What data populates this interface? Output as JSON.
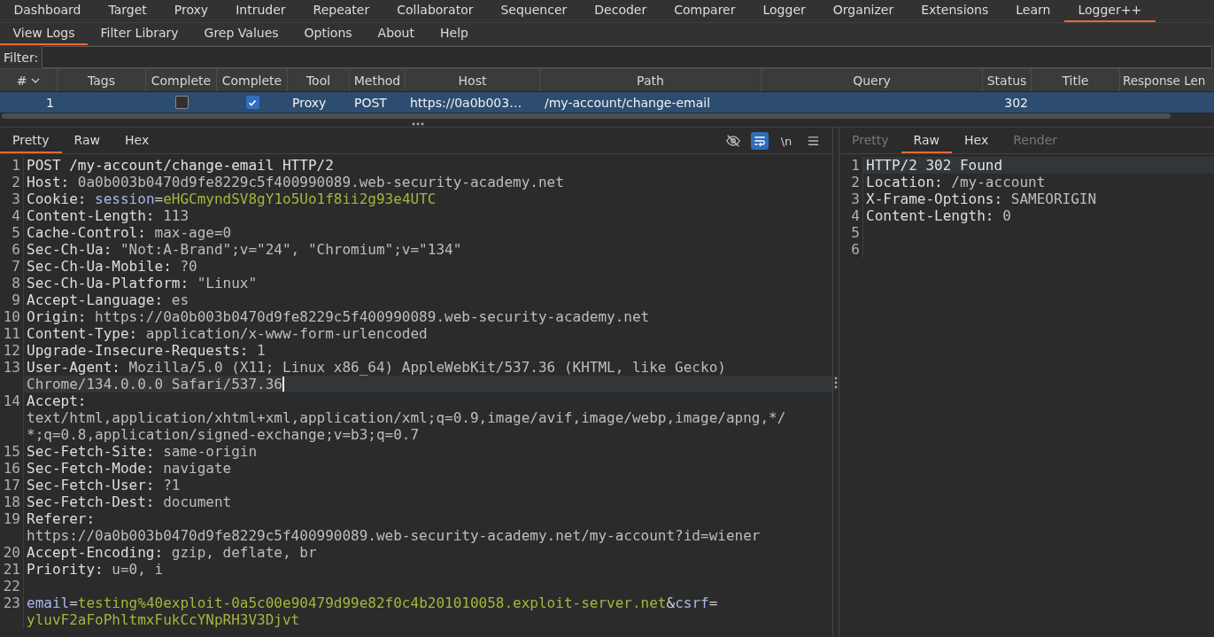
{
  "main_tabs": [
    {
      "label": "Dashboard",
      "selected": false
    },
    {
      "label": "Target",
      "selected": false
    },
    {
      "label": "Proxy",
      "selected": false
    },
    {
      "label": "Intruder",
      "selected": false
    },
    {
      "label": "Repeater",
      "selected": false
    },
    {
      "label": "Collaborator",
      "selected": false
    },
    {
      "label": "Sequencer",
      "selected": false
    },
    {
      "label": "Decoder",
      "selected": false
    },
    {
      "label": "Comparer",
      "selected": false
    },
    {
      "label": "Logger",
      "selected": false
    },
    {
      "label": "Organizer",
      "selected": false
    },
    {
      "label": "Extensions",
      "selected": false
    },
    {
      "label": "Learn",
      "selected": false
    },
    {
      "label": "Logger++",
      "selected": true
    }
  ],
  "sub_tabs": [
    {
      "label": "View Logs",
      "selected": true
    },
    {
      "label": "Filter Library",
      "selected": false
    },
    {
      "label": "Grep Values",
      "selected": false
    },
    {
      "label": "Options",
      "selected": false
    },
    {
      "label": "About",
      "selected": false
    },
    {
      "label": "Help",
      "selected": false
    }
  ],
  "filter": {
    "label": "Filter:"
  },
  "table": {
    "columns": [
      {
        "label": "#",
        "sorted": true
      },
      {
        "label": "Tags",
        "sorted": false
      },
      {
        "label": "Complete",
        "sorted": false
      },
      {
        "label": "Complete",
        "sorted": false
      },
      {
        "label": "Tool",
        "sorted": false
      },
      {
        "label": "Method",
        "sorted": false
      },
      {
        "label": "Host",
        "sorted": false
      },
      {
        "label": "Path",
        "sorted": false
      },
      {
        "label": "Query",
        "sorted": false
      },
      {
        "label": "Status",
        "sorted": false
      },
      {
        "label": "Title",
        "sorted": false
      },
      {
        "label": "Response Len",
        "sorted": false
      }
    ],
    "rows": [
      {
        "selected": true,
        "cells": [
          {
            "kind": "number",
            "text": "1"
          },
          {
            "kind": "empty"
          },
          {
            "kind": "checkbox",
            "checked": false
          },
          {
            "kind": "checkbox",
            "checked": true
          },
          {
            "kind": "text",
            "text": "Proxy"
          },
          {
            "kind": "text",
            "text": "POST"
          },
          {
            "kind": "text",
            "text": "https://0a0b003…"
          },
          {
            "kind": "text",
            "text": "/my-account/change-email"
          },
          {
            "kind": "empty"
          },
          {
            "kind": "number",
            "text": "302"
          },
          {
            "kind": "empty"
          },
          {
            "kind": "empty"
          }
        ]
      }
    ]
  },
  "request": {
    "tabs": [
      {
        "label": "Pretty",
        "selected": true,
        "disabled": false
      },
      {
        "label": "Raw",
        "selected": false,
        "disabled": false
      },
      {
        "label": "Hex",
        "selected": false,
        "disabled": false
      }
    ],
    "toolbar": [
      {
        "kind": "hide",
        "selected": false
      },
      {
        "kind": "wrap",
        "selected": true
      },
      {
        "kind": "text",
        "text": "\\n",
        "selected": false
      },
      {
        "kind": "menu",
        "selected": false
      }
    ],
    "lines": [
      {
        "number": "1",
        "cursor": false,
        "rows": [
          [
            {
              "kind": "plain",
              "text": "POST /my-account/change-email HTTP/2"
            }
          ]
        ]
      },
      {
        "number": "2",
        "cursor": false,
        "rows": [
          [
            {
              "kind": "name",
              "text": "Host:"
            },
            {
              "kind": "value",
              "text": " 0a0b003b0470d9fe8229c5f400990089.web-security-academy.net"
            }
          ]
        ]
      },
      {
        "number": "3",
        "cursor": false,
        "rows": [
          [
            {
              "kind": "name",
              "text": "Cookie:"
            },
            {
              "kind": "value",
              "text": " "
            },
            {
              "kind": "param",
              "text": "session"
            },
            {
              "kind": "sep",
              "text": "="
            },
            {
              "kind": "param-value",
              "text": "eHGCmyndSV8gY1o5Uo1f8ii2g93e4UTC"
            }
          ]
        ]
      },
      {
        "number": "4",
        "cursor": false,
        "rows": [
          [
            {
              "kind": "name",
              "text": "Content-Length:"
            },
            {
              "kind": "value",
              "text": " 113"
            }
          ]
        ]
      },
      {
        "number": "5",
        "cursor": false,
        "rows": [
          [
            {
              "kind": "name",
              "text": "Cache-Control:"
            },
            {
              "kind": "value",
              "text": " max-age=0"
            }
          ]
        ]
      },
      {
        "number": "6",
        "cursor": false,
        "rows": [
          [
            {
              "kind": "name",
              "text": "Sec-Ch-Ua:"
            },
            {
              "kind": "value",
              "text": " \"Not:A-Brand\";v=\"24\", \"Chromium\";v=\"134\""
            }
          ]
        ]
      },
      {
        "number": "7",
        "cursor": false,
        "rows": [
          [
            {
              "kind": "name",
              "text": "Sec-Ch-Ua-Mobile:"
            },
            {
              "kind": "value",
              "text": " ?0"
            }
          ]
        ]
      },
      {
        "number": "8",
        "cursor": false,
        "rows": [
          [
            {
              "kind": "name",
              "text": "Sec-Ch-Ua-Platform:"
            },
            {
              "kind": "value",
              "text": " \"Linux\""
            }
          ]
        ]
      },
      {
        "number": "9",
        "cursor": false,
        "rows": [
          [
            {
              "kind": "name",
              "text": "Accept-Language:"
            },
            {
              "kind": "value",
              "text": " es"
            }
          ]
        ]
      },
      {
        "number": "10",
        "cursor": false,
        "rows": [
          [
            {
              "kind": "name",
              "text": "Origin:"
            },
            {
              "kind": "value",
              "text": " https://0a0b003b0470d9fe8229c5f400990089.web-security-academy.net"
            }
          ]
        ]
      },
      {
        "number": "11",
        "cursor": false,
        "rows": [
          [
            {
              "kind": "name",
              "text": "Content-Type:"
            },
            {
              "kind": "value",
              "text": " application/x-www-form-urlencoded"
            }
          ]
        ]
      },
      {
        "number": "12",
        "cursor": false,
        "rows": [
          [
            {
              "kind": "name",
              "text": "Upgrade-Insecure-Requests:"
            },
            {
              "kind": "value",
              "text": " 1"
            }
          ]
        ]
      },
      {
        "number": "13",
        "cursor": true,
        "rows": [
          [
            {
              "kind": "name",
              "text": "User-Agent:"
            },
            {
              "kind": "value",
              "text": " Mozilla/5.0 (X11; Linux x86_64) AppleWebKit/537.36 (KHTML, like Gecko)"
            }
          ],
          [
            {
              "kind": "value",
              "text": "Chrome/134.0.0.0 Safari/537.36"
            }
          ]
        ]
      },
      {
        "number": "14",
        "cursor": false,
        "rows": [
          [
            {
              "kind": "name",
              "text": "Accept:"
            }
          ],
          [
            {
              "kind": "value",
              "text": "text/html,application/xhtml+xml,application/xml;q=0.9,image/avif,image/webp,image/apng,*/"
            }
          ],
          [
            {
              "kind": "value",
              "text": "*;q=0.8,application/signed-exchange;v=b3;q=0.7"
            }
          ]
        ]
      },
      {
        "number": "15",
        "cursor": false,
        "rows": [
          [
            {
              "kind": "name",
              "text": "Sec-Fetch-Site:"
            },
            {
              "kind": "value",
              "text": " same-origin"
            }
          ]
        ]
      },
      {
        "number": "16",
        "cursor": false,
        "rows": [
          [
            {
              "kind": "name",
              "text": "Sec-Fetch-Mode:"
            },
            {
              "kind": "value",
              "text": " navigate"
            }
          ]
        ]
      },
      {
        "number": "17",
        "cursor": false,
        "rows": [
          [
            {
              "kind": "name",
              "text": "Sec-Fetch-User:"
            },
            {
              "kind": "value",
              "text": " ?1"
            }
          ]
        ]
      },
      {
        "number": "18",
        "cursor": false,
        "rows": [
          [
            {
              "kind": "name",
              "text": "Sec-Fetch-Dest:"
            },
            {
              "kind": "value",
              "text": " document"
            }
          ]
        ]
      },
      {
        "number": "19",
        "cursor": false,
        "rows": [
          [
            {
              "kind": "name",
              "text": "Referer:"
            }
          ],
          [
            {
              "kind": "value",
              "text": "https://0a0b003b0470d9fe8229c5f400990089.web-security-academy.net/my-account?id=wiener"
            }
          ]
        ]
      },
      {
        "number": "20",
        "cursor": false,
        "rows": [
          [
            {
              "kind": "name",
              "text": "Accept-Encoding:"
            },
            {
              "kind": "value",
              "text": " gzip, deflate, br"
            }
          ]
        ]
      },
      {
        "number": "21",
        "cursor": false,
        "rows": [
          [
            {
              "kind": "name",
              "text": "Priority:"
            },
            {
              "kind": "value",
              "text": " u=0, i"
            }
          ]
        ]
      },
      {
        "number": "22",
        "cursor": false
      },
      {
        "number": "23",
        "cursor": false,
        "rows": [
          [
            {
              "kind": "param",
              "text": "email"
            },
            {
              "kind": "sep",
              "text": "="
            },
            {
              "kind": "param-value",
              "text": "testing%40exploit-0a5c00e90479d99e82f0c4b201010058.exploit-server.net"
            },
            {
              "kind": "sep",
              "text": "&"
            },
            {
              "kind": "param",
              "text": "csrf"
            },
            {
              "kind": "sep",
              "text": "="
            }
          ],
          [
            {
              "kind": "param-value",
              "text": "yluvF2aFoPhltmxFukCcYNpRH3V3Djvt"
            }
          ]
        ]
      }
    ]
  },
  "response": {
    "tabs": [
      {
        "label": "Pretty",
        "selected": false,
        "disabled": true
      },
      {
        "label": "Raw",
        "selected": true,
        "disabled": false
      },
      {
        "label": "Hex",
        "selected": false,
        "disabled": false
      },
      {
        "label": "Render",
        "selected": false,
        "disabled": true
      }
    ],
    "lines": [
      {
        "number": "1",
        "cursor": true,
        "rows": [
          [
            {
              "kind": "plain",
              "text": "HTTP/2 302 Found"
            }
          ]
        ]
      },
      {
        "number": "2",
        "cursor": false,
        "rows": [
          [
            {
              "kind": "name",
              "text": "Location:"
            },
            {
              "kind": "value",
              "text": " /my-account"
            }
          ]
        ]
      },
      {
        "number": "3",
        "cursor": false,
        "rows": [
          [
            {
              "kind": "name",
              "text": "X-Frame-Options:"
            },
            {
              "kind": "value",
              "text": " SAMEORIGIN"
            }
          ]
        ]
      },
      {
        "number": "4",
        "cursor": false,
        "rows": [
          [
            {
              "kind": "name",
              "text": "Content-Length:"
            },
            {
              "kind": "value",
              "text": " 0"
            }
          ]
        ]
      },
      {
        "number": "5",
        "cursor": false
      },
      {
        "number": "6",
        "cursor": false
      }
    ]
  }
}
